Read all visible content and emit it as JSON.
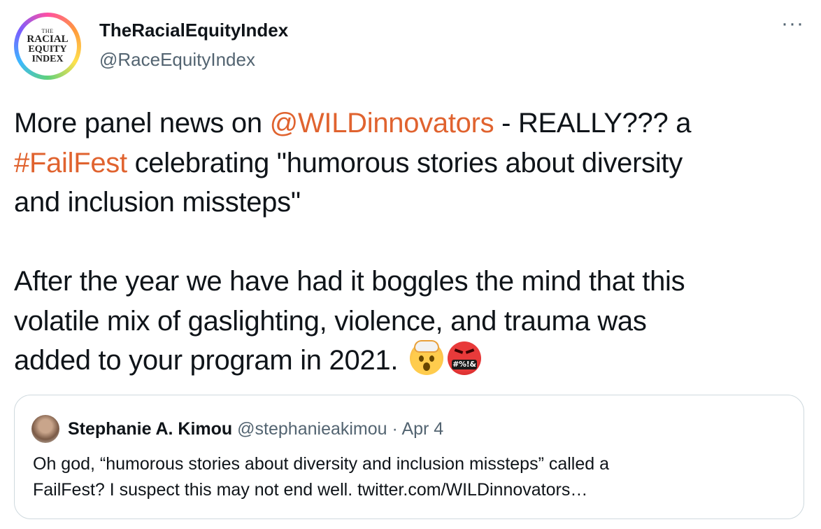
{
  "author": {
    "display_name": "TheRacialEquityIndex",
    "handle": "@RaceEquityIndex",
    "avatar_text": [
      "THE",
      "RACIAL",
      "EQUITY",
      "INDEX"
    ]
  },
  "menu": {
    "more_label": "···"
  },
  "tweet": {
    "line1_pre": "More panel news on ",
    "mention": "@WILDinnovators",
    "line1_post": " - REALLY??? a",
    "hashtag": "#FailFest",
    "line2_post": " celebrating \"humorous stories about diversity",
    "line3": "and inclusion missteps\"",
    "line4": "After the year we have had it boggles the mind that this",
    "line5": "volatile mix of gaslighting, violence, and trauma was",
    "line6": "added to your program in 2021. ",
    "emoji_1": "exploding-head-emoji",
    "emoji_2": "face-with-symbols-on-mouth-emoji",
    "emoji_2_text": "#%!&"
  },
  "quoted_tweet": {
    "display_name": "Stephanie A. Kimou",
    "handle": "@stephanieakimou",
    "separator": "·",
    "date": "Apr 4",
    "line1": "Oh god, “humorous stories about diversity and inclusion missteps” called a",
    "line2": "FailFest? I suspect this may not end well. twitter.com/WILDinnovators…"
  },
  "colors": {
    "link": "#e0632f",
    "text": "#0f1419",
    "secondary": "#536471",
    "border": "#cfd9de"
  }
}
